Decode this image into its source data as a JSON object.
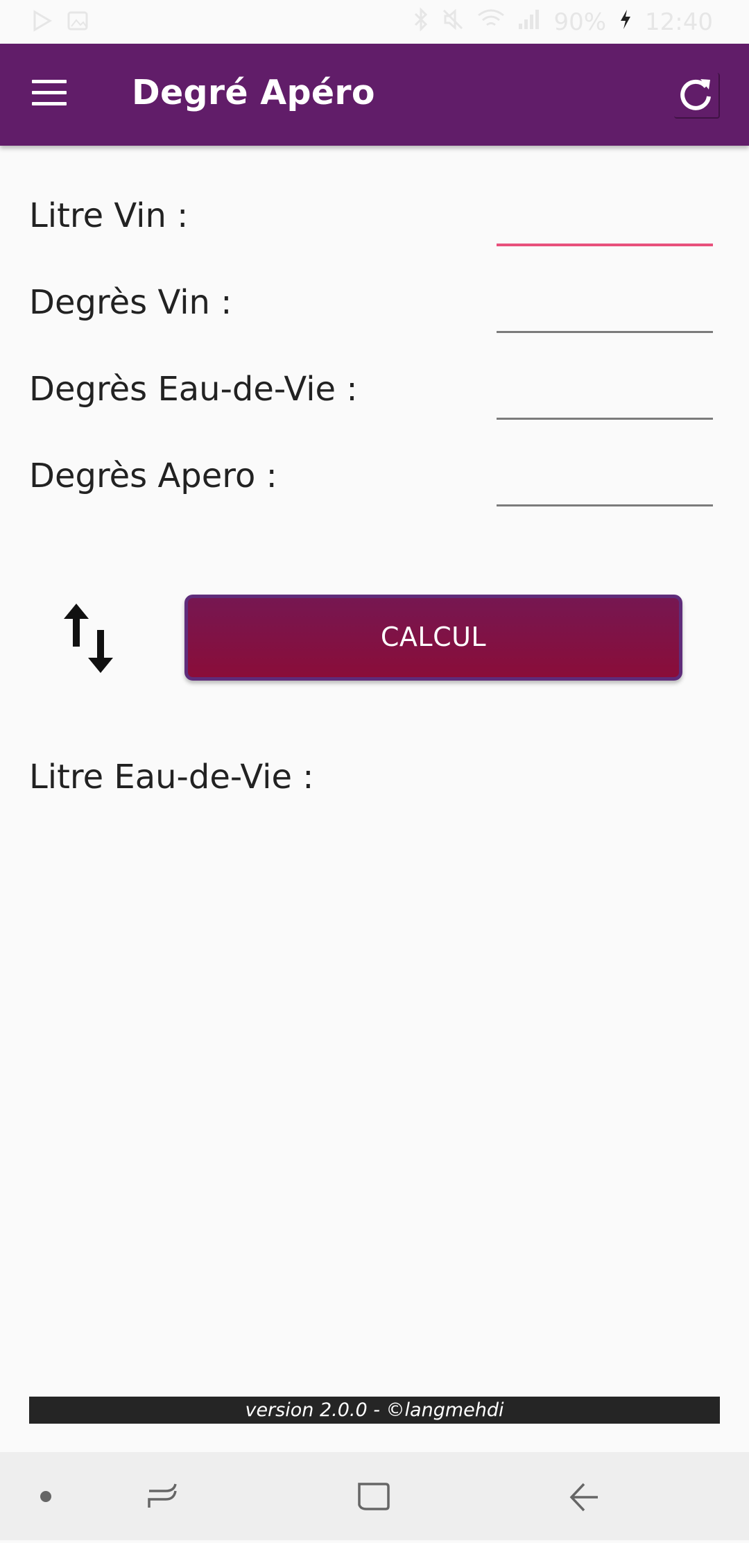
{
  "status_bar": {
    "battery": "90%",
    "time": "12:40",
    "left_icons": [
      "play-store-icon",
      "image-icon"
    ],
    "right_icons": [
      "bluetooth-icon",
      "mute-icon",
      "wifi-icon",
      "signal-icon",
      "charging-icon"
    ]
  },
  "app_bar": {
    "title": "Degré Apéro",
    "color": "#611d69",
    "menu_icon": "hamburger-menu-icon",
    "refresh_icon": "refresh-icon"
  },
  "form": {
    "rows": [
      {
        "label": "Litre Vin :",
        "value": "",
        "focused": true
      },
      {
        "label": "Degrès Vin :",
        "value": "",
        "focused": false
      },
      {
        "label": "Degrès Eau-de-Vie :",
        "value": "",
        "focused": false
      },
      {
        "label": "Degrès Apero :",
        "value": "",
        "focused": false
      }
    ],
    "focus_color": "#e8517c"
  },
  "actions": {
    "swap_icon": "swap-vertical-arrows-icon",
    "calc_label": "CALCUL",
    "calc_color": "#7e1146"
  },
  "result": {
    "label": "Litre Eau-de-Vie :"
  },
  "footer": {
    "version_text": "version 2.0.0 - ©langmehdi"
  },
  "nav_bar": {
    "items": [
      "dot-icon",
      "recent-apps-icon",
      "home-icon",
      "back-icon"
    ]
  }
}
